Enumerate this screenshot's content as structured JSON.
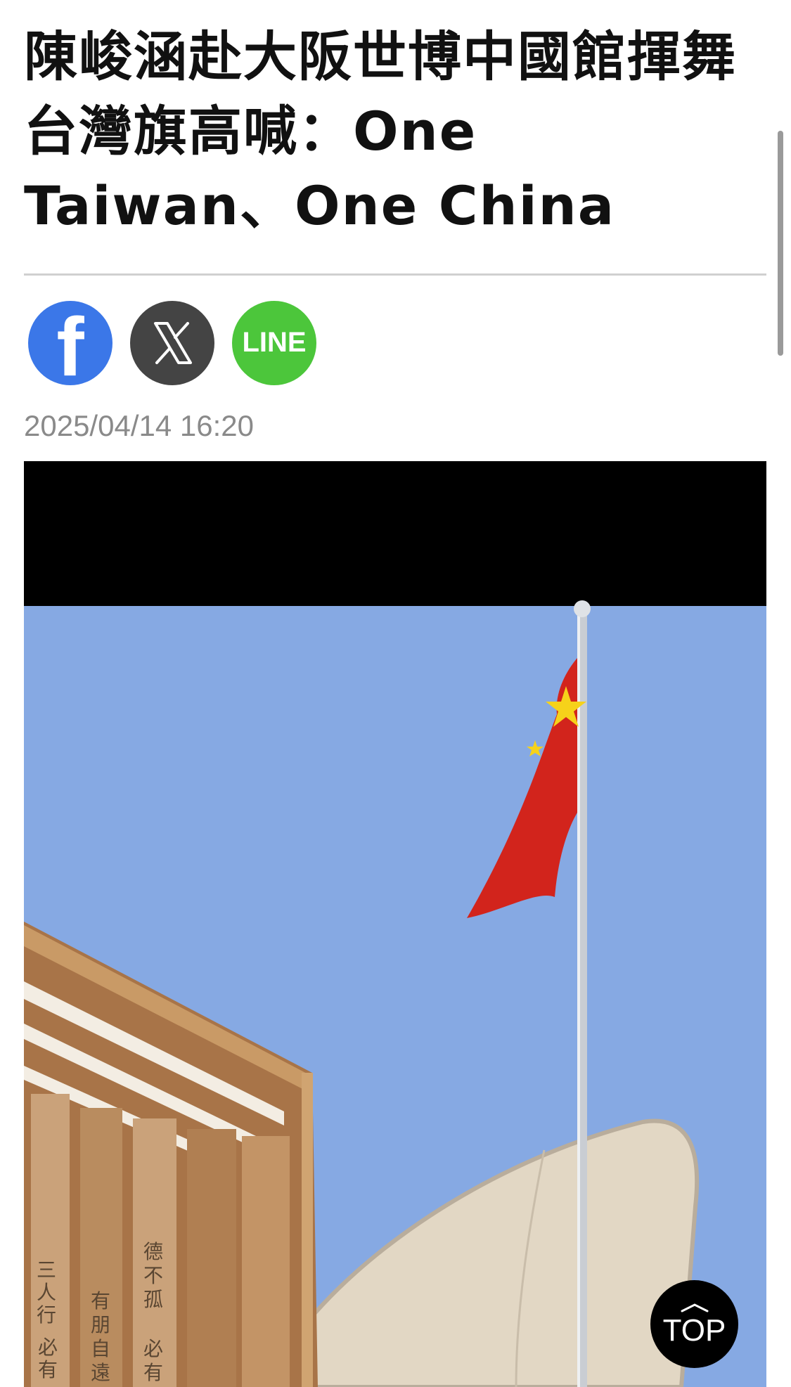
{
  "article": {
    "headline": "陳峻涵赴大阪世博中國館揮舞台灣旗高喊：One Taiwan、One China",
    "timestamp": "2025/04/14 16:20"
  },
  "share": {
    "facebook_glyph": "f",
    "line_label": "LINE",
    "icons": [
      "facebook-icon",
      "x-icon",
      "line-icon"
    ],
    "colors": {
      "facebook": "#3b77e8",
      "x": "#444444",
      "line": "#4cc63b"
    }
  },
  "media": {
    "colors": {
      "sky": "#86a9e3",
      "flag": "#d2241c",
      "star": "#f6d21a",
      "pavilion": "#b8834d",
      "canopy": "#e2d7c4"
    }
  },
  "back_to_top": {
    "label": "TOP"
  }
}
